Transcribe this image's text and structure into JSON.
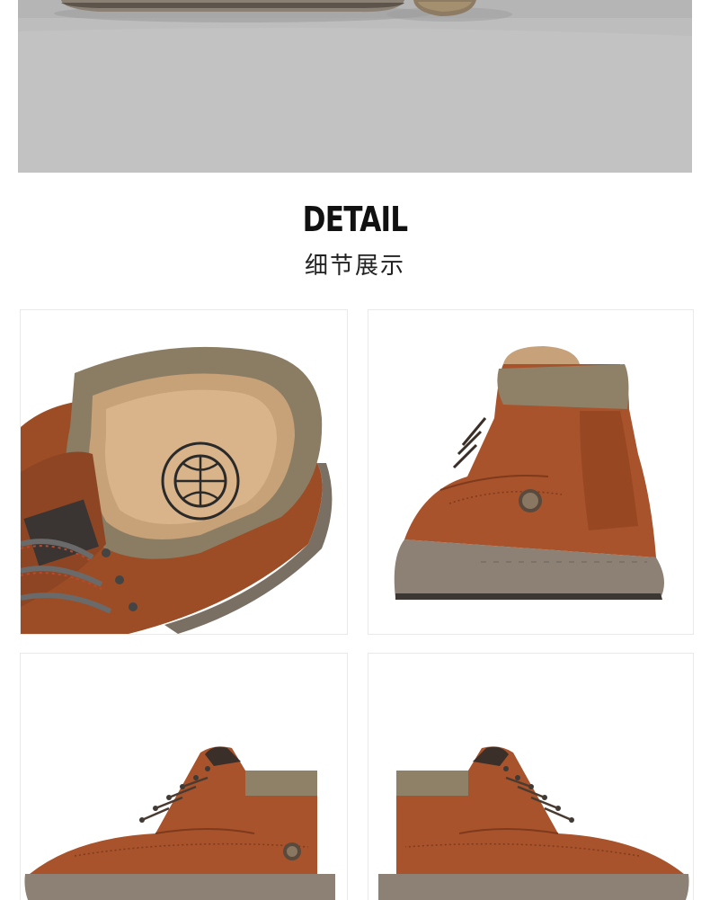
{
  "section": {
    "title": "DETAIL",
    "subtitle": "细节展示"
  },
  "images": [
    {
      "name": "shoe-sole-photo",
      "content": "boot-soles-on-floor"
    },
    {
      "name": "collar-detail-photo",
      "content": "boot-inner-collar-closeup"
    },
    {
      "name": "heel-detail-photo",
      "content": "boot-rear-three-quarter"
    },
    {
      "name": "side-detail-photo-left",
      "content": "boot-side-profile"
    },
    {
      "name": "side-detail-photo-right",
      "content": "boot-side-profile-mirrored"
    }
  ],
  "colors": {
    "leather": "#a9532a",
    "leather_dark": "#7e3a1c",
    "collar": "#8e8167",
    "sole": "#8c8174",
    "floor": "#b9b9b9"
  }
}
